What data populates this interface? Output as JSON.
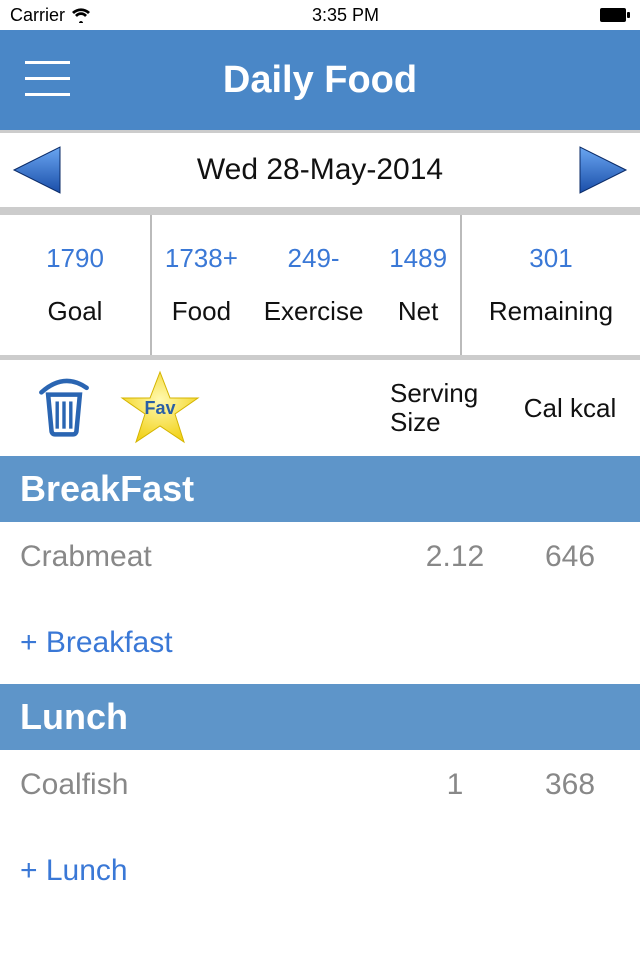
{
  "statusbar": {
    "carrier": "Carrier",
    "time": "3:35 PM"
  },
  "nav": {
    "title": "Daily Food"
  },
  "date": {
    "label": "Wed 28-May-2014"
  },
  "stats": {
    "goal": {
      "value": "1790",
      "label": "Goal"
    },
    "food": {
      "value": "1738+",
      "label": "Food"
    },
    "exercise": {
      "value": "249-",
      "label": "Exercise"
    },
    "net": {
      "value": "1489",
      "label": "Net"
    },
    "remaining": {
      "value": "301",
      "label": "Remaining"
    }
  },
  "columns": {
    "serving": "Serving Size",
    "cal": "Cal kcal"
  },
  "fav": {
    "label": "Fav"
  },
  "sections": [
    {
      "title": "BreakFast",
      "items": [
        {
          "name": "Crabmeat",
          "serving": "2.12",
          "cal": "646"
        }
      ],
      "add": "+ Breakfast"
    },
    {
      "title": "Lunch",
      "items": [
        {
          "name": "Coalfish",
          "serving": "1",
          "cal": "368"
        }
      ],
      "add": "+ Lunch"
    }
  ]
}
